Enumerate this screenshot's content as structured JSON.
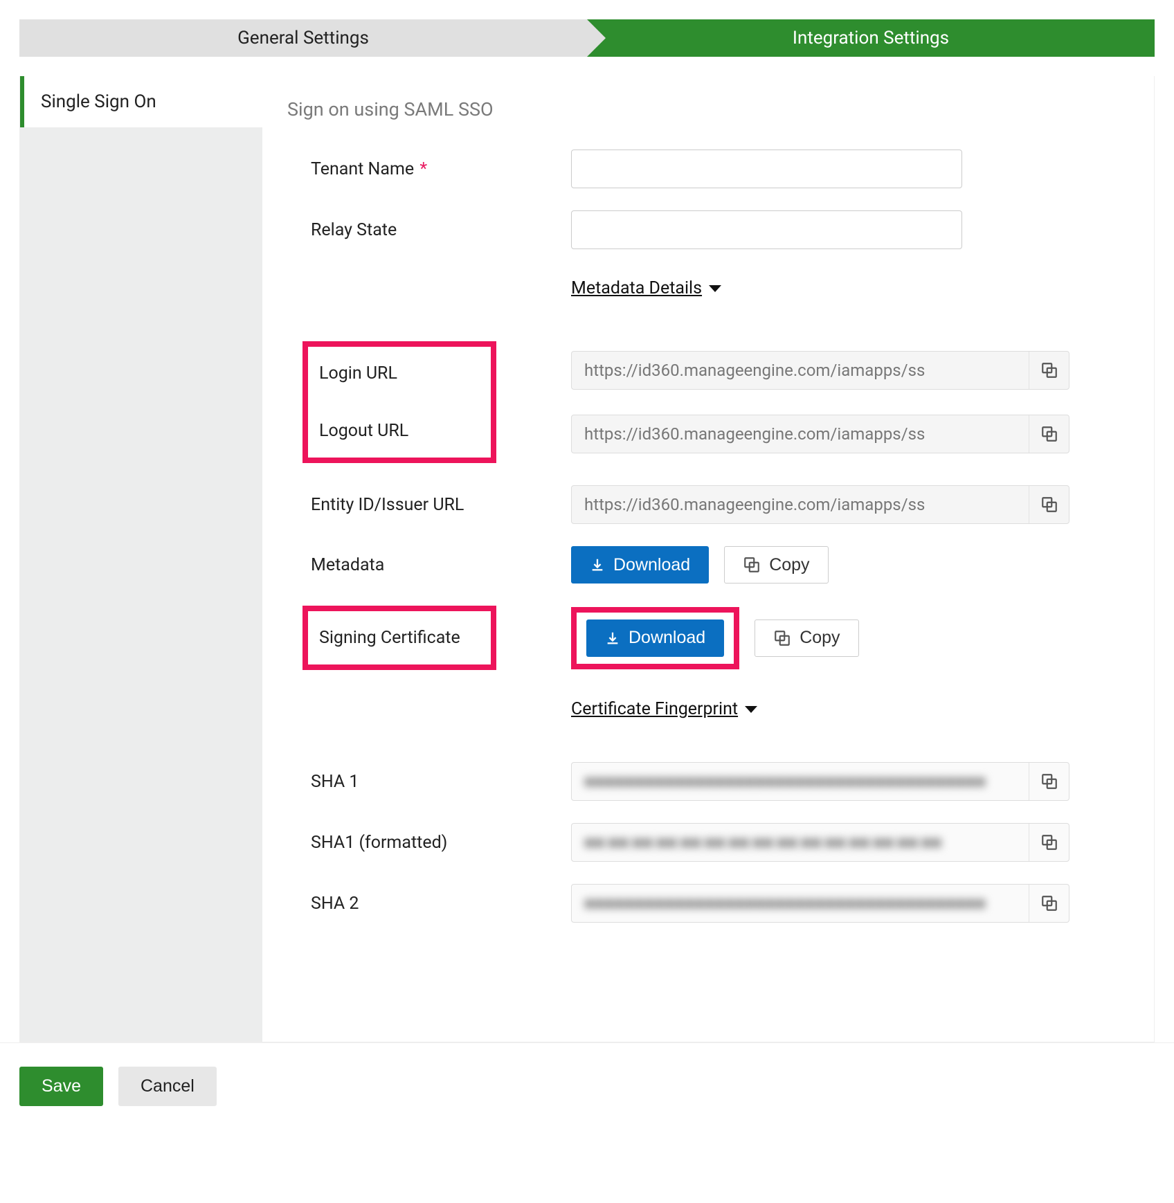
{
  "steps": {
    "general": "General Settings",
    "integration": "Integration Settings"
  },
  "sidebar": {
    "item": "Single Sign On"
  },
  "section": {
    "title": "Sign on using SAML SSO"
  },
  "labels": {
    "tenant_name": "Tenant Name",
    "relay_state": "Relay State",
    "login_url": "Login URL",
    "logout_url": "Logout URL",
    "entity_id": "Entity ID/Issuer URL",
    "metadata": "Metadata",
    "signing_cert": "Signing Certificate",
    "sha1": "SHA 1",
    "sha1_fmt": "SHA1 (formatted)",
    "sha2": "SHA 2"
  },
  "headings": {
    "metadata_details": "Metadata Details",
    "cert_fingerprint": "Certificate Fingerprint "
  },
  "values": {
    "login_url": "https://id360.manageengine.com/iamapps/ss",
    "logout_url": "https://id360.manageengine.com/iamapps/ss",
    "entity_id": "https://id360.manageengine.com/iamapps/ss",
    "tenant_name": "",
    "relay_state": ""
  },
  "buttons": {
    "download": "Download",
    "copy": "Copy",
    "save": "Save",
    "cancel": "Cancel"
  }
}
